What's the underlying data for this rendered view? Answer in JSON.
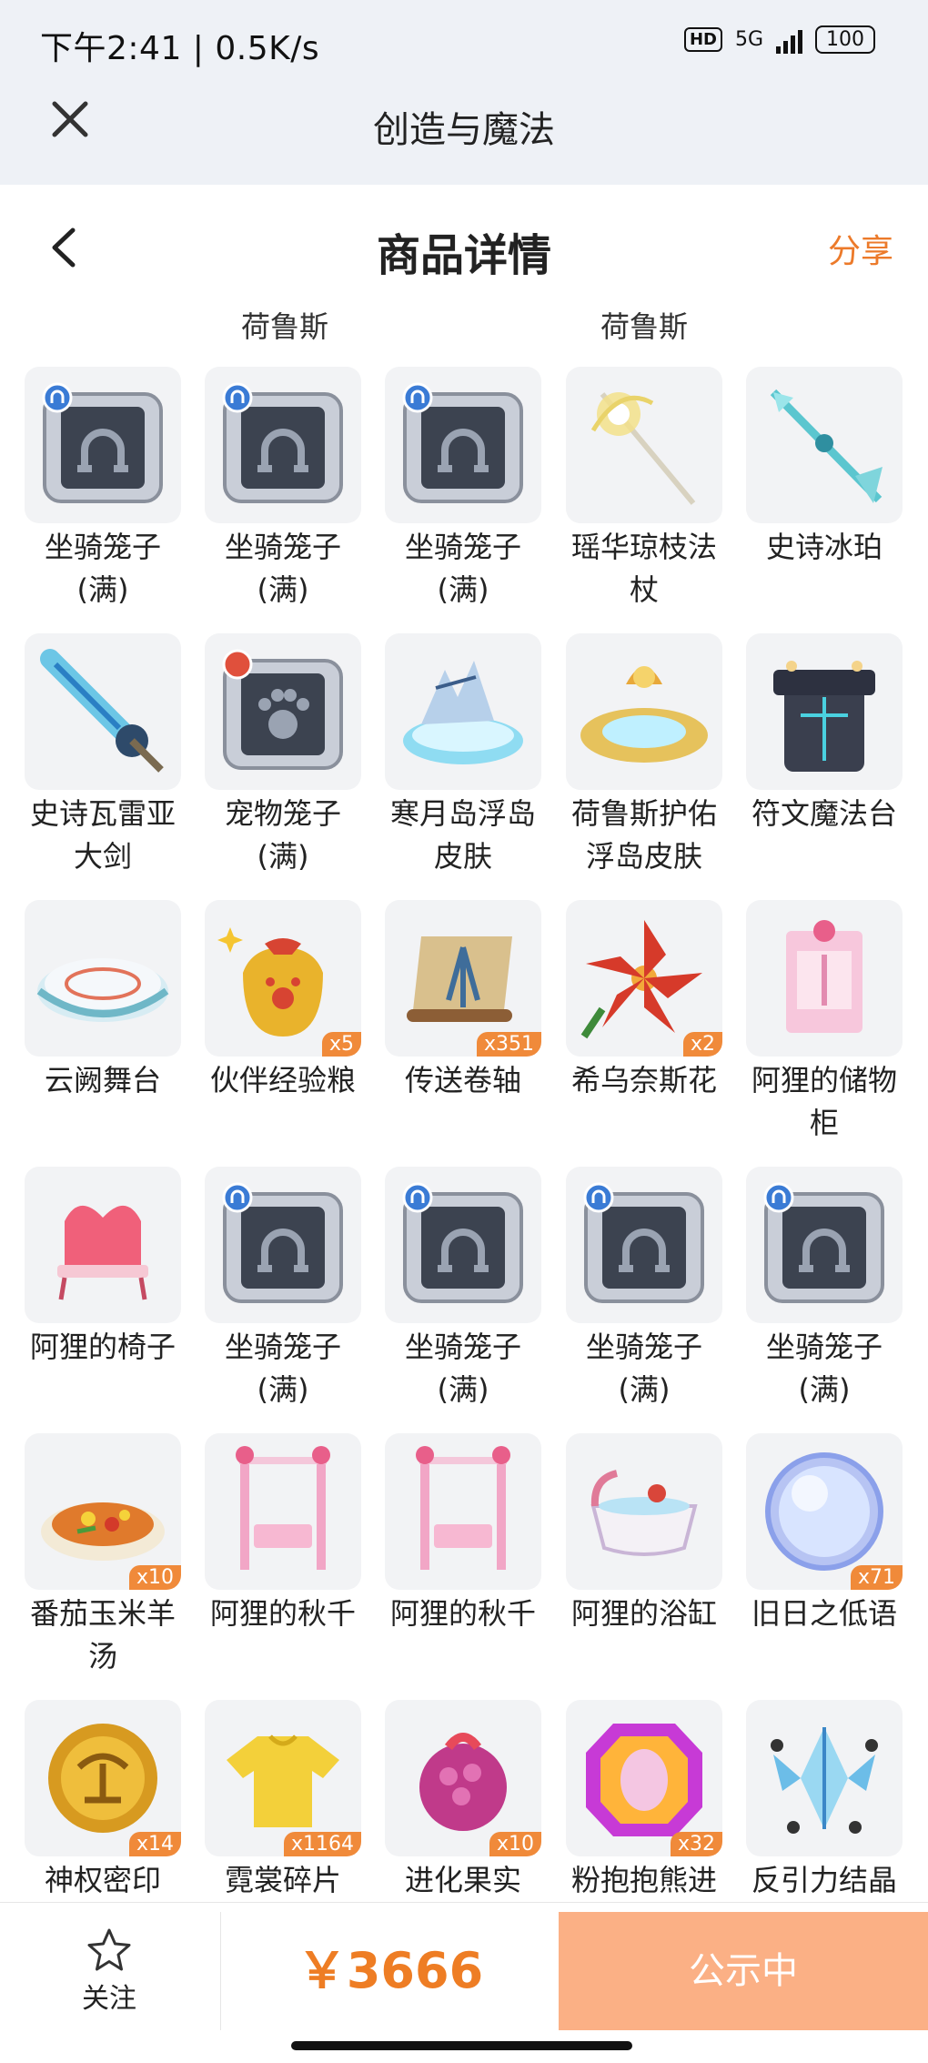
{
  "status_bar": {
    "time_text": "下午2:41 | 0.5K/s",
    "network": "5G",
    "battery": "100"
  },
  "app": {
    "title": "创造与魔法",
    "close_icon": "close-icon"
  },
  "header": {
    "title": "商品详情",
    "share_label": "分享",
    "back_icon": "back-arrow-icon"
  },
  "server_labels": [
    "荷鲁斯",
    "荷鲁斯"
  ],
  "items": [
    {
      "name": "坐骑笼子\n(满)",
      "icon": "mount-cage",
      "qty": ""
    },
    {
      "name": "坐骑笼子\n(满)",
      "icon": "mount-cage",
      "qty": ""
    },
    {
      "name": "坐骑笼子\n(满)",
      "icon": "mount-cage",
      "qty": ""
    },
    {
      "name": "瑶华琼枝法\n杖",
      "icon": "staff",
      "qty": ""
    },
    {
      "name": "史诗冰珀",
      "icon": "ice-spear",
      "qty": ""
    },
    {
      "name": "史诗瓦雷亚\n大剑",
      "icon": "greatsword",
      "qty": ""
    },
    {
      "name": "宠物笼子\n(满)",
      "icon": "pet-cage",
      "qty": ""
    },
    {
      "name": "寒月岛浮岛\n皮肤",
      "icon": "ice-island",
      "qty": ""
    },
    {
      "name": "荷鲁斯护佑\n浮岛皮肤",
      "icon": "gold-island",
      "qty": ""
    },
    {
      "name": "符文魔法台",
      "icon": "rune-altar",
      "qty": ""
    },
    {
      "name": "云阙舞台",
      "icon": "stage",
      "qty": ""
    },
    {
      "name": "伙伴经验粮",
      "icon": "exp-bag",
      "qty": "x5"
    },
    {
      "name": "传送卷轴",
      "icon": "scroll",
      "qty": "x351"
    },
    {
      "name": "希乌奈斯花",
      "icon": "red-flower",
      "qty": "x2"
    },
    {
      "name": "阿狸的储物\n柜",
      "icon": "pink-cabinet",
      "qty": ""
    },
    {
      "name": "阿狸的椅子",
      "icon": "pink-chair",
      "qty": ""
    },
    {
      "name": "坐骑笼子\n(满)",
      "icon": "mount-cage",
      "qty": ""
    },
    {
      "name": "坐骑笼子\n(满)",
      "icon": "mount-cage",
      "qty": ""
    },
    {
      "name": "坐骑笼子\n(满)",
      "icon": "mount-cage",
      "qty": ""
    },
    {
      "name": "坐骑笼子\n(满)",
      "icon": "mount-cage",
      "qty": ""
    },
    {
      "name": "番茄玉米羊\n汤",
      "icon": "soup",
      "qty": "x10"
    },
    {
      "name": "阿狸的秋千",
      "icon": "swing",
      "qty": ""
    },
    {
      "name": "阿狸的秋千",
      "icon": "swing",
      "qty": ""
    },
    {
      "name": "阿狸的浴缸",
      "icon": "bathtub",
      "qty": ""
    },
    {
      "name": "旧日之低语",
      "icon": "orb",
      "qty": "x71"
    },
    {
      "name": "神权密印",
      "icon": "gold-coin",
      "qty": "x14"
    },
    {
      "name": "霓裳碎片",
      "icon": "shirt",
      "qty": "x1164"
    },
    {
      "name": "进化果实",
      "icon": "berry",
      "qty": "x10"
    },
    {
      "name": "粉抱抱熊进",
      "icon": "gem-egg",
      "qty": "x32"
    },
    {
      "name": "反引力结晶",
      "icon": "crystal",
      "qty": ""
    }
  ],
  "bottom_bar": {
    "follow_label": "关注",
    "follow_icon": "star-outline-icon",
    "price": "￥3666",
    "status_button": "公示中"
  }
}
